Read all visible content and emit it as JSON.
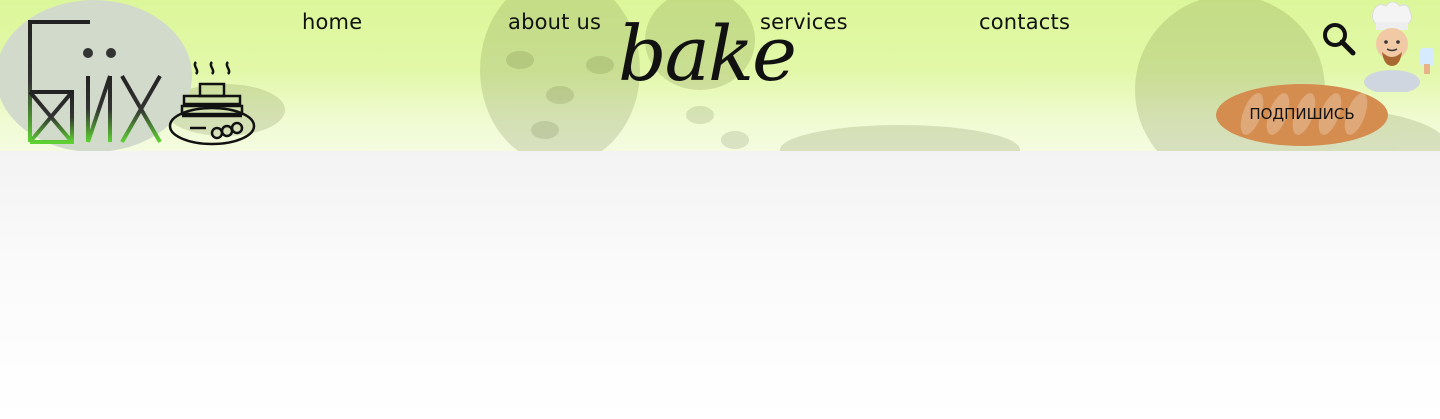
{
  "nav": {
    "items": [
      {
        "label": "home"
      },
      {
        "label": "about us"
      },
      {
        "label": "services"
      },
      {
        "label": "contacts"
      }
    ]
  },
  "header": {
    "brand_logo_text": "БИX",
    "wordmark": "bake",
    "subscribe_label": "ПОДПИШИСЬ",
    "icons": [
      "search-icon",
      "chef-avatar-icon",
      "pancake-stack-icon"
    ]
  },
  "colors": {
    "header_top": "#dcf79a",
    "header_bottom": "#f4fbe0",
    "subscribe_button": "#d48c4f",
    "logo_gradient_start": "#222222",
    "logo_gradient_end": "#5fd133",
    "page_background": "#f5f5f5"
  }
}
